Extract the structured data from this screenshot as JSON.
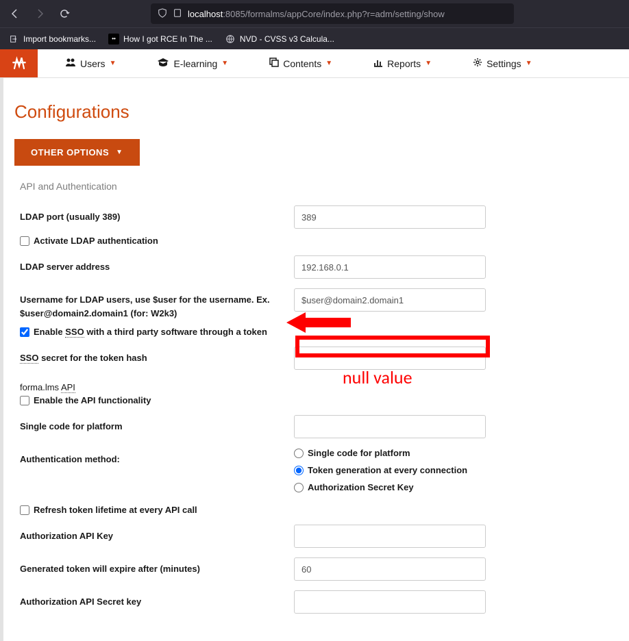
{
  "browser": {
    "url_host": "localhost",
    "url_port": ":8085",
    "url_path": "/formalms/appCore/index.php?r=adm/setting/show"
  },
  "bookmarks": [
    {
      "label": "Import bookmarks..."
    },
    {
      "label": "How I got RCE In The ..."
    },
    {
      "label": "NVD - CVSS v3 Calcula..."
    }
  ],
  "nav": {
    "users": "Users",
    "elearning": "E-learning",
    "contents": "Contents",
    "reports": "Reports",
    "settings": "Settings"
  },
  "page": {
    "title": "Configurations",
    "dropdown": "OTHER OPTIONS",
    "section": "API and Authentication"
  },
  "fields": {
    "ldap_port_label": "LDAP port (usually 389)",
    "ldap_port_value": "389",
    "activate_ldap_label": "Activate LDAP authentication",
    "ldap_server_label": "LDAP server address",
    "ldap_server_value": "192.168.0.1",
    "ldap_user_label": "Username for LDAP users, use $user for the username. Ex. $user@domain2.domain1 (for: W2k3)",
    "ldap_user_value": "$user@domain2.domain1",
    "enable_sso_label_1": "Enable ",
    "enable_sso_label_2": "SSO",
    "enable_sso_label_3": " with a third party software through a token",
    "sso_secret_label_1": "SSO",
    "sso_secret_label_2": " secret for the token hash",
    "sso_secret_value": "",
    "api_subsection_1": "forma.lms ",
    "api_subsection_2": "API",
    "enable_api_label": "Enable the API functionality",
    "single_code_label": "Single code for platform",
    "single_code_value": "",
    "auth_method_label": "Authentication method:",
    "radio_single_code": "Single code for platform",
    "radio_token_gen": "Token generation at every connection",
    "radio_auth_secret": "Authorization Secret Key",
    "refresh_token_label": "Refresh token lifetime at every API call",
    "auth_api_key_label": "Authorization API Key",
    "auth_api_key_value": "",
    "token_expire_label": "Generated token will expire after (minutes)",
    "token_expire_value": "60",
    "auth_secret_key_label": "Authorization API Secret key",
    "auth_secret_key_value": ""
  },
  "annotations": {
    "null_value": "null value"
  }
}
